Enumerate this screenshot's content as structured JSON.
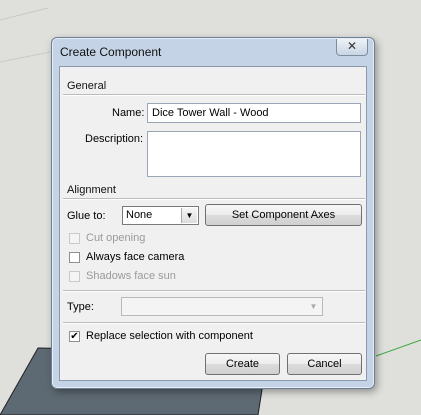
{
  "dialog": {
    "title": "Create Component",
    "close_symbol": "✕",
    "general": {
      "section_label": "General",
      "name_label": "Name:",
      "name_value": "Dice Tower Wall - Wood",
      "description_label": "Description:",
      "description_value": ""
    },
    "alignment": {
      "section_label": "Alignment",
      "glue_label": "Glue to:",
      "glue_value": "None",
      "set_axes_label": "Set Component Axes",
      "cut_opening": {
        "label": "Cut opening",
        "checked": false,
        "enabled": false
      },
      "always_face_camera": {
        "label": "Always face camera",
        "checked": false,
        "enabled": true
      },
      "shadows_face_sun": {
        "label": "Shadows face sun",
        "checked": false,
        "enabled": false
      }
    },
    "type": {
      "label": "Type:",
      "value": ""
    },
    "replace_selection": {
      "label": "Replace selection with component",
      "checked": true,
      "mark": "✔"
    },
    "create_label": "Create",
    "cancel_label": "Cancel"
  },
  "colors": {
    "frame": "#c4d4e6",
    "client": "#f0f0f0",
    "model_face": "#5e6a73",
    "background": "#dfe0dc",
    "axis_line": "#3aa53a"
  }
}
